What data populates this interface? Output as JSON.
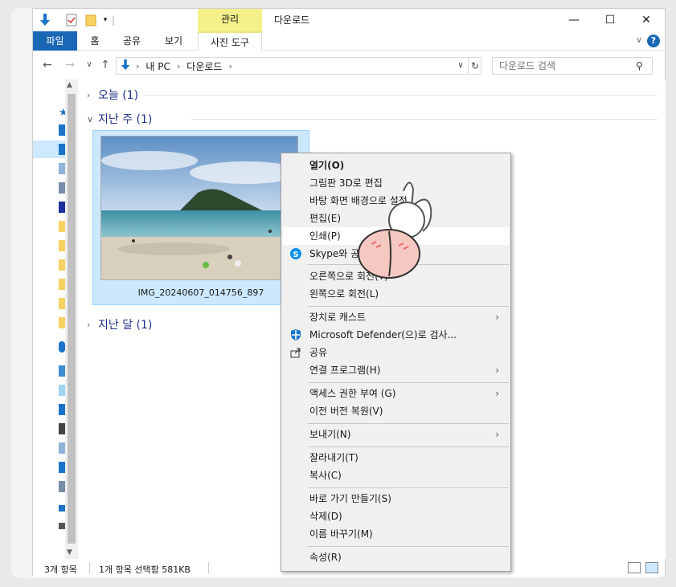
{
  "window": {
    "title": "다운로드",
    "context_tab_group": "관리",
    "minimize": "—",
    "maximize": "☐",
    "close": "✕"
  },
  "ribbon": {
    "tabs": [
      "파일",
      "홈",
      "공유",
      "보기",
      "사진 도구"
    ],
    "help": "?"
  },
  "address": {
    "crumbs": [
      "내 PC",
      "다운로드"
    ],
    "search_placeholder": "다운로드 검색"
  },
  "groups": [
    {
      "label": "오늘 (1)",
      "expanded": false
    },
    {
      "label": "지난 주 (1)",
      "expanded": true
    },
    {
      "label": "지난 달 (1)",
      "expanded": false
    }
  ],
  "file": {
    "name": "IMG_20240607_014756_897"
  },
  "status": {
    "item_count": "3개 항목",
    "selection": "1개 항목 선택함 581KB"
  },
  "context_menu": {
    "items": [
      {
        "label": "열기(O)",
        "bold": true
      },
      {
        "label": "그림판 3D로 편집"
      },
      {
        "label": "바탕 화면 배경으로 설정"
      },
      {
        "label": "편집(E)"
      },
      {
        "label": "인쇄(P)",
        "highlighted": true
      },
      {
        "label": "Skype와 공유",
        "icon": "skype-icon"
      },
      {
        "label": "오른쪽으로 회전(T)"
      },
      {
        "label": "왼쪽으로 회전(L)"
      },
      {
        "label": "장치로 캐스트",
        "submenu": true
      },
      {
        "label": "Microsoft Defender(으)로 검사...",
        "icon": "defender-shield-icon"
      },
      {
        "label": "공유",
        "icon": "share-icon"
      },
      {
        "label": "연결 프로그램(H)",
        "submenu": true
      },
      {
        "label": "액세스 권한 부여 (G)",
        "submenu": true
      },
      {
        "label": "이전 버전 복원(V)"
      },
      {
        "label": "보내기(N)",
        "submenu": true
      },
      {
        "label": "잘라내기(T)"
      },
      {
        "label": "복사(C)"
      },
      {
        "label": "바로 가기 만들기(S)"
      },
      {
        "label": "삭제(D)"
      },
      {
        "label": "이름 바꾸기(M)"
      },
      {
        "label": "속성(R)"
      }
    ]
  },
  "colors": {
    "file_tab": "#1a67b5",
    "context_tab": "#f4f08a",
    "selection": "#cce8ff",
    "group_header": "#1e3287"
  }
}
